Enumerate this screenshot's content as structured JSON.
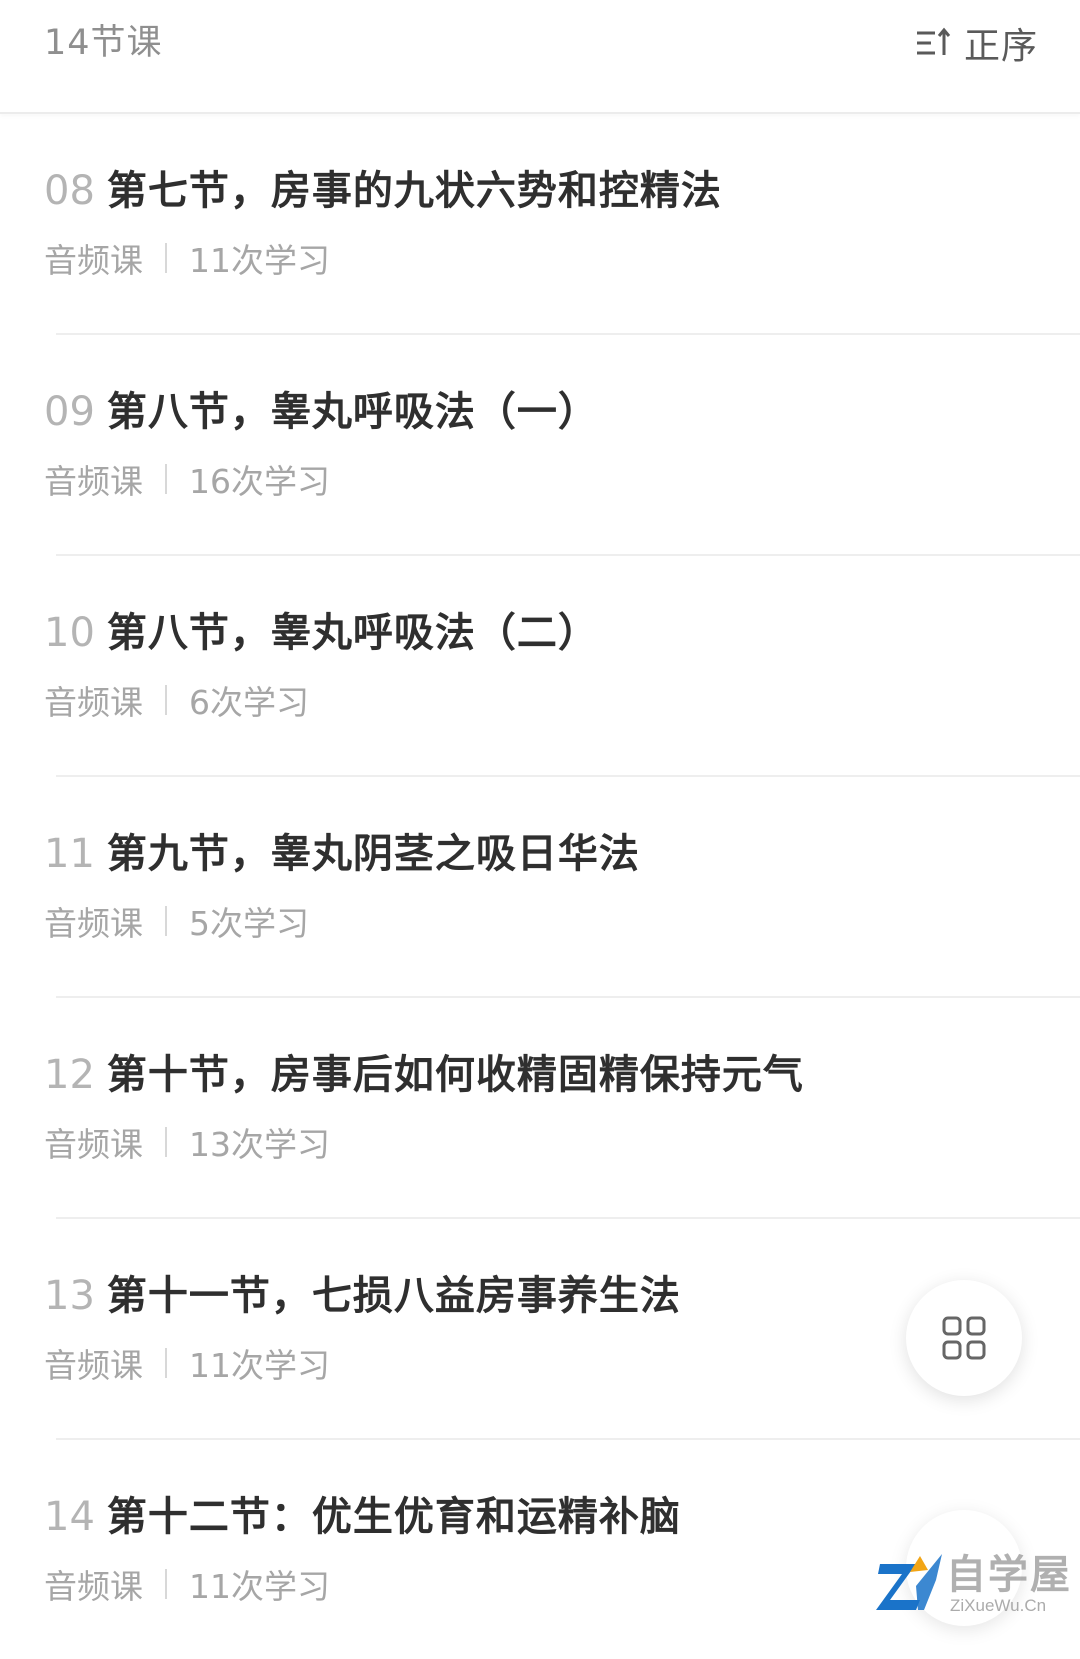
{
  "header": {
    "lesson_count": "14节课",
    "sort_label": "正序",
    "sort_icon": "sort-order-icon"
  },
  "lessons": [
    {
      "index": "08",
      "title": "第七节，房事的九状六势和控精法",
      "type": "音频课",
      "views": "11次学习"
    },
    {
      "index": "09",
      "title": "第八节，睾丸呼吸法（一）",
      "type": "音频课",
      "views": "16次学习"
    },
    {
      "index": "10",
      "title": "第八节，睾丸呼吸法（二）",
      "type": "音频课",
      "views": "6次学习"
    },
    {
      "index": "11",
      "title": "第九节，睾丸阴茎之吸日华法",
      "type": "音频课",
      "views": "5次学习"
    },
    {
      "index": "12",
      "title": "第十节，房事后如何收精固精保持元气",
      "type": "音频课",
      "views": "13次学习"
    },
    {
      "index": "13",
      "title": "第十一节，七损八益房事养生法",
      "type": "音频课",
      "views": "11次学习"
    },
    {
      "index": "14",
      "title": "第十二节：优生优育和运精补脑",
      "type": "音频课",
      "views": "11次学习"
    }
  ],
  "fab": {
    "icon": "grid-icon"
  },
  "watermark": {
    "text": "自学屋",
    "url": "ZiXueWu.Cn"
  }
}
